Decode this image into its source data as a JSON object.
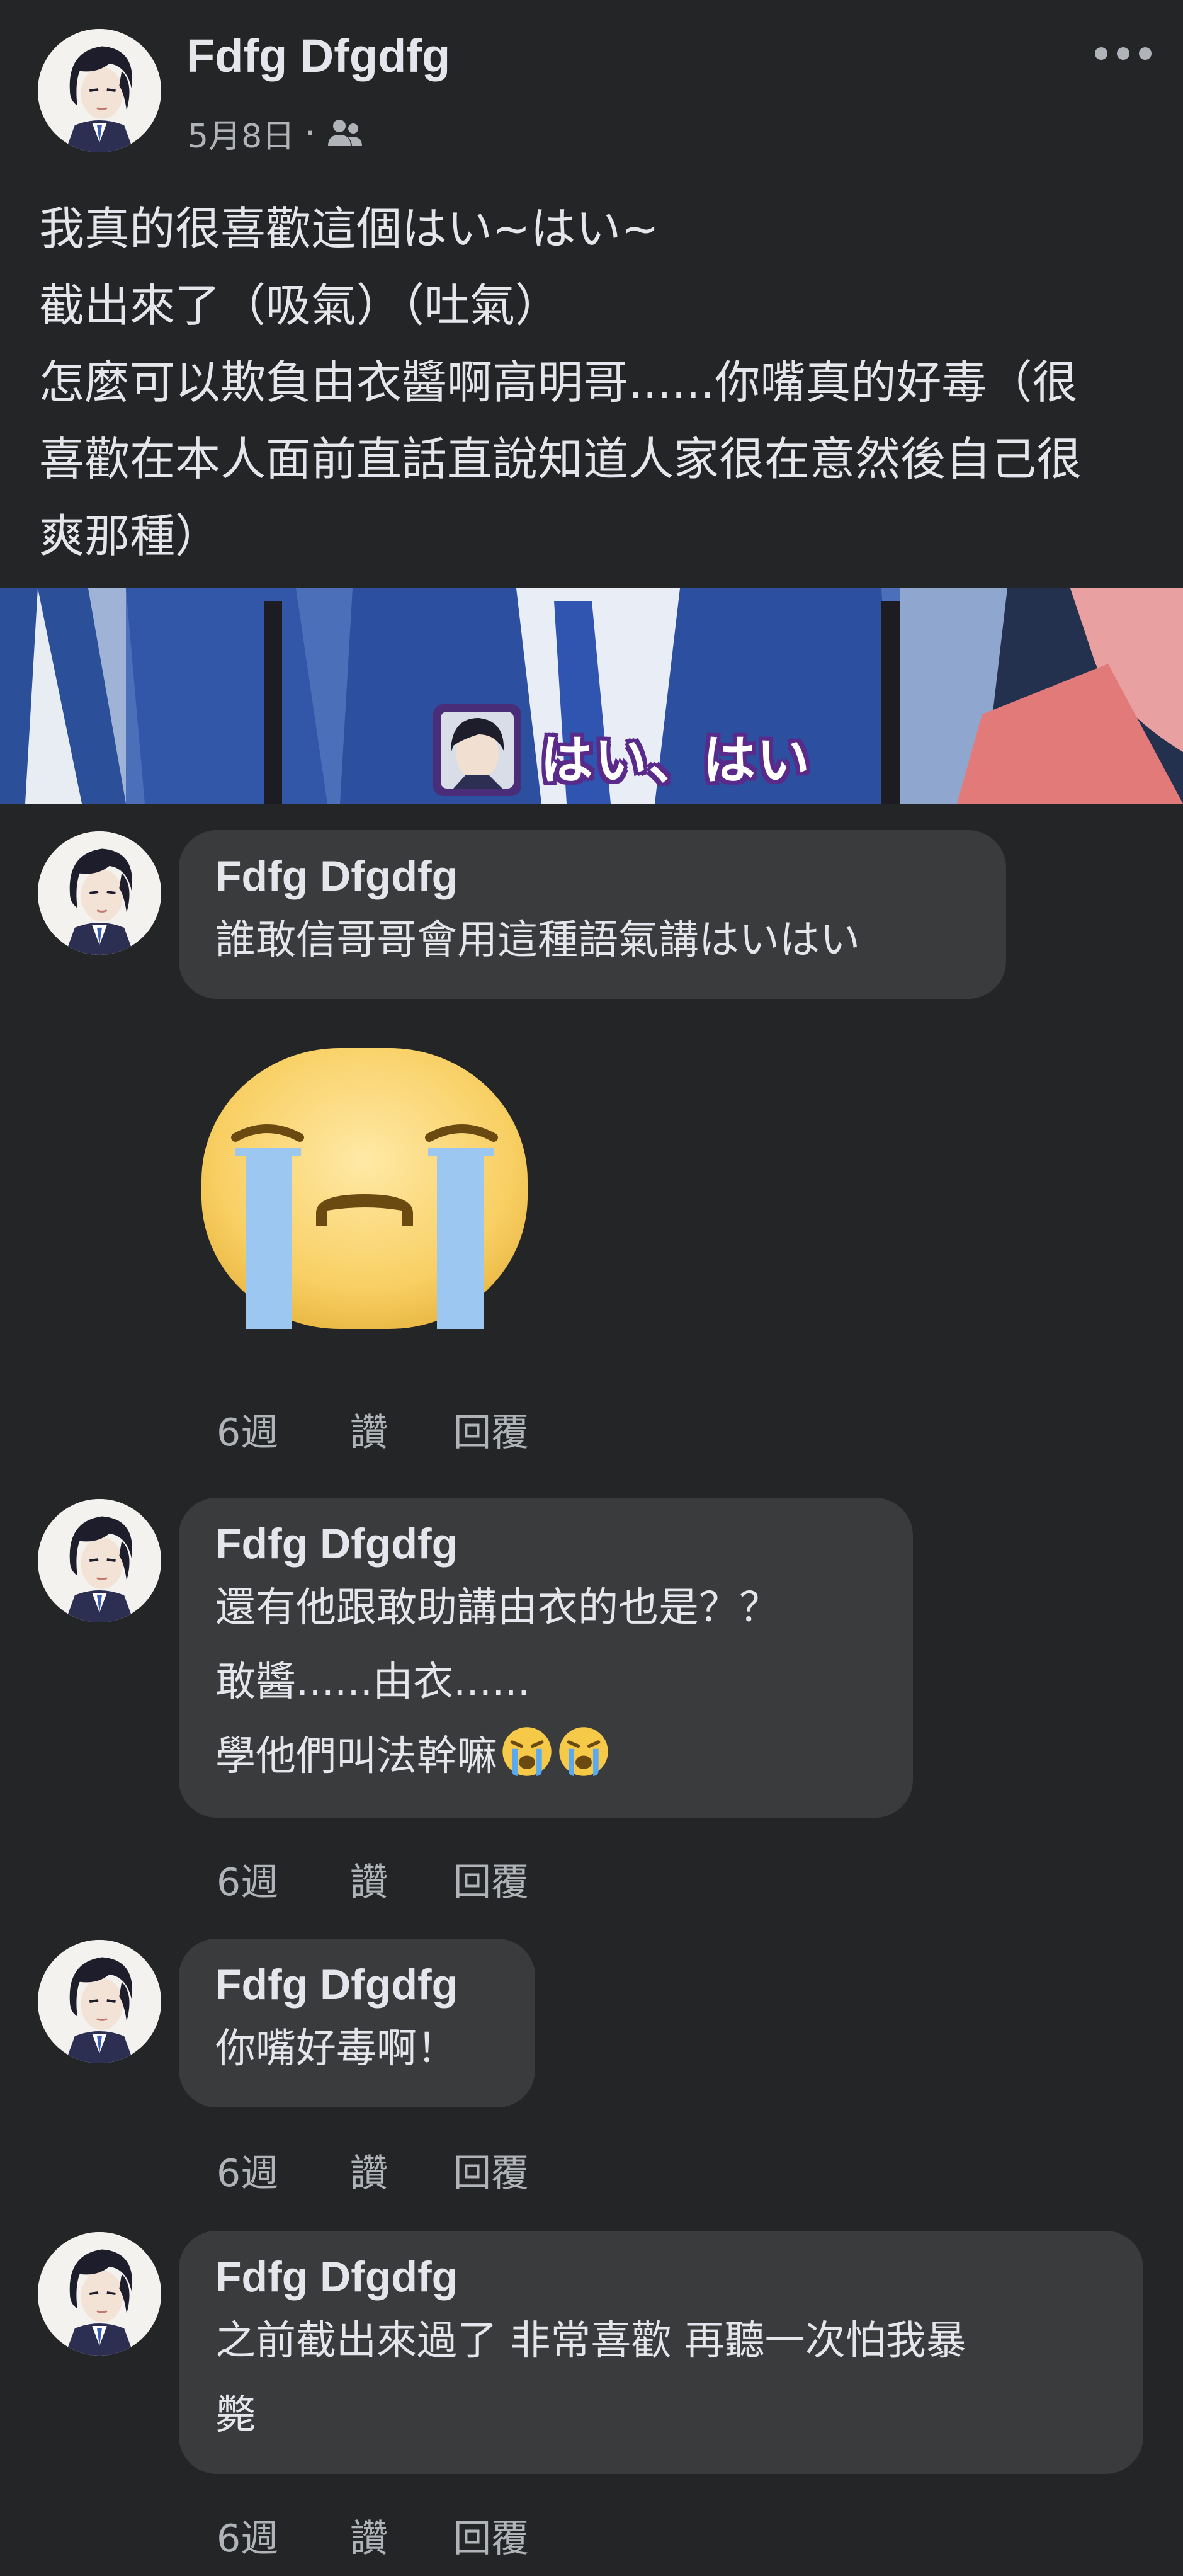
{
  "post": {
    "author": "Fdfg Dfgdfg",
    "date": "5月8日",
    "separator": "·",
    "audience_icon": "friends-icon",
    "lines": [
      "我真的很喜歡這個はい~はい~",
      "截出來了（吸氣）（吐氣）",
      "怎麼可以欺負由衣醬啊高明哥......你嘴真的好毒（很",
      "喜歡在本人面前直話直說知道人家很在意然後自己很",
      "爽那種）"
    ],
    "image_subtitle": "はい、はい"
  },
  "comments": [
    {
      "author": "Fdfg Dfgdfg",
      "lines": [
        "誰敢信哥哥會用這種語氣講はいはい"
      ],
      "sticker": "crying-face-sticker",
      "time": "6週",
      "like": "讚",
      "reply": "回覆"
    },
    {
      "author": "Fdfg Dfgdfg",
      "lines": [
        "還有他跟敢助講由衣的也是？？",
        "敢醬......由衣......",
        "學他們叫法幹嘛"
      ],
      "emoji": "😭😭",
      "time": "6週",
      "like": "讚",
      "reply": "回覆"
    },
    {
      "author": "Fdfg Dfgdfg",
      "lines": [
        "你嘴好毒啊！"
      ],
      "time": "6週",
      "like": "讚",
      "reply": "回覆"
    },
    {
      "author": "Fdfg Dfgdfg",
      "lines": [
        "之前截出來過了 非常喜歡 再聽一次怕我暴",
        "斃"
      ],
      "time": "6週",
      "like": "讚",
      "reply": "回覆"
    }
  ],
  "colors": {
    "background": "#242526",
    "bubble": "#3a3b3c",
    "text": "#e4e6eb",
    "secondary": "#b0b3b8"
  }
}
